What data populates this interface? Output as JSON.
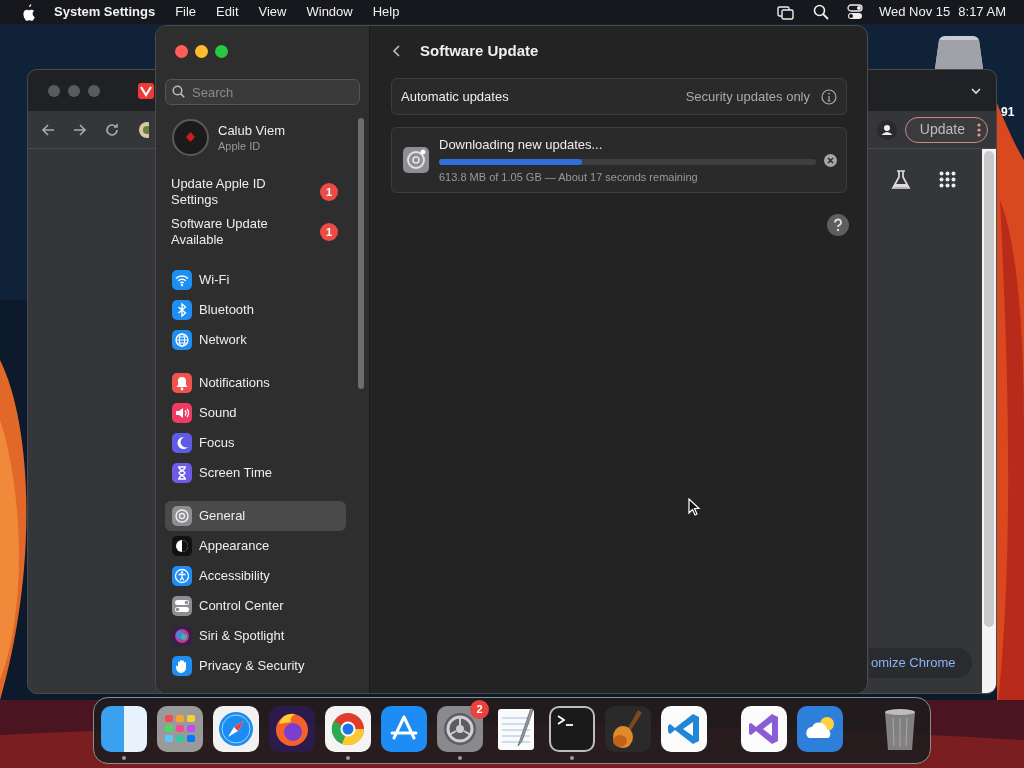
{
  "menu_bar": {
    "app_name": "System Settings",
    "menus": [
      "File",
      "Edit",
      "View",
      "Window",
      "Help"
    ],
    "date": "Wed Nov 15",
    "time": "8:17 AM"
  },
  "desktop": {
    "edge_text": "91"
  },
  "browser_window": {
    "update_button": "Update",
    "customize_button": "omize Chrome"
  },
  "settings_window": {
    "search": {
      "placeholder": "Search"
    },
    "account": {
      "name": "Calub Viem",
      "subtitle": "Apple ID"
    },
    "notices": [
      {
        "label": "Update Apple ID Settings",
        "badge": "1"
      },
      {
        "label": "Software Update Available",
        "badge": "1"
      }
    ],
    "sidebar_groups": [
      {
        "items": [
          {
            "label": "Wi-Fi",
            "selected": false
          },
          {
            "label": "Bluetooth",
            "selected": false
          },
          {
            "label": "Network",
            "selected": false
          }
        ]
      },
      {
        "items": [
          {
            "label": "Notifications",
            "selected": false
          },
          {
            "label": "Sound",
            "selected": false
          },
          {
            "label": "Focus",
            "selected": false
          },
          {
            "label": "Screen Time",
            "selected": false
          }
        ]
      },
      {
        "items": [
          {
            "label": "General",
            "selected": true
          },
          {
            "label": "Appearance",
            "selected": false
          },
          {
            "label": "Accessibility",
            "selected": false
          },
          {
            "label": "Control Center",
            "selected": false
          },
          {
            "label": "Siri & Spotlight",
            "selected": false
          },
          {
            "label": "Privacy & Security",
            "selected": false
          }
        ]
      }
    ],
    "page": {
      "title": "Software Update",
      "automatic_updates": {
        "label": "Automatic updates",
        "value": "Security updates only"
      },
      "download": {
        "title": "Downloading new updates...",
        "level": 0.38,
        "detail": "613.8 MB of 1.05 GB — About 17 seconds remaining"
      }
    }
  },
  "dock": {
    "items": [
      {
        "kind": "app",
        "running": true
      },
      {
        "kind": "app",
        "running": false
      },
      {
        "kind": "app",
        "running": false
      },
      {
        "kind": "app",
        "running": false
      },
      {
        "kind": "app",
        "running": true
      },
      {
        "kind": "app",
        "running": false
      },
      {
        "kind": "app",
        "running": true,
        "badge": "2"
      },
      {
        "kind": "app",
        "running": false
      },
      {
        "kind": "app",
        "running": true
      },
      {
        "kind": "app",
        "running": false
      },
      {
        "kind": "app",
        "running": false
      },
      {
        "kind": "separator"
      },
      {
        "kind": "app",
        "running": false
      },
      {
        "kind": "app",
        "running": false
      },
      {
        "kind": "separator"
      },
      {
        "kind": "app",
        "running": false
      }
    ]
  }
}
